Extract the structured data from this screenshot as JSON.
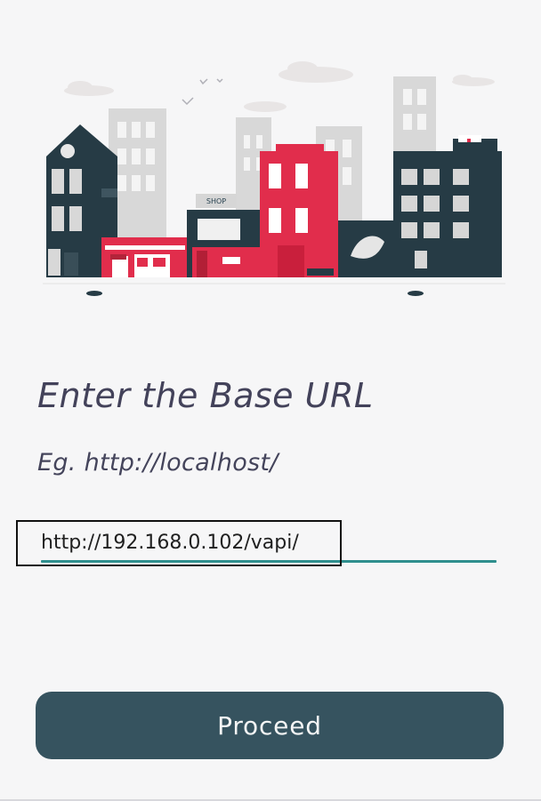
{
  "screen": {
    "heading": "Enter the Base URL",
    "example": "Eg. http://localhost/"
  },
  "url_input": {
    "value": "http://192.168.0.102/vapi/"
  },
  "proceed_button": {
    "label": "Proceed"
  },
  "illustration": {
    "shop_sign": "SHOP",
    "colors": {
      "dark": "#263b45",
      "red": "#e12d4c",
      "accent": "#2f8f8e",
      "button": "#36535f"
    }
  }
}
